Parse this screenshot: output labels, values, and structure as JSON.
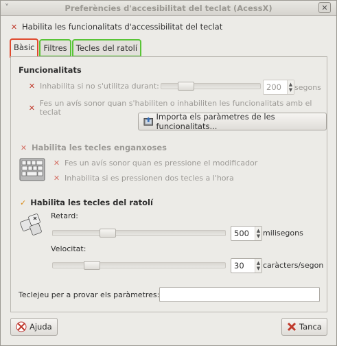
{
  "window": {
    "title": "Preferències d'accesibilitat del teclat (AcessX)"
  },
  "enable_all": {
    "label": "Habilita les funcionalitats d'accessibilitat del teclat"
  },
  "tabs": [
    {
      "label": "Bàsic"
    },
    {
      "label": "Filtres"
    },
    {
      "label": "Tecles del ratolí"
    }
  ],
  "features": {
    "title": "Funcionalitats",
    "disable_unused": {
      "label": "Inhabilita si no s'utilitza durant:",
      "value": "200",
      "unit": "segons"
    },
    "beep_on_toggle": {
      "label": "Fes un avís sonor quan s'habiliten o inhabiliten les funcionalitats amb el teclat"
    },
    "import_button": "Importa els paràmetres de les funcionalitats..."
  },
  "sticky_keys": {
    "label": "Habilita les tecles enganxoses",
    "beep_modifier": "Fes un avís sonor quan es pressione el modificador",
    "disable_two": "Inhabilita si es pressionen dos tecles a l'hora"
  },
  "mouse_keys": {
    "label": "Habilita les tecles del ratolí",
    "delay": {
      "label": "Retard:",
      "value": "500",
      "unit": "milisegons",
      "level": 0.3
    },
    "speed": {
      "label": "Velocitat:",
      "value": "30",
      "unit": "caràcters/segon",
      "level": 0.2
    }
  },
  "test": {
    "label": "Teclejeu per a provar els paràmetres:",
    "value": ""
  },
  "buttons": {
    "help": "Ajuda",
    "close": "Tanca"
  },
  "disable_unused_level": 0.2
}
